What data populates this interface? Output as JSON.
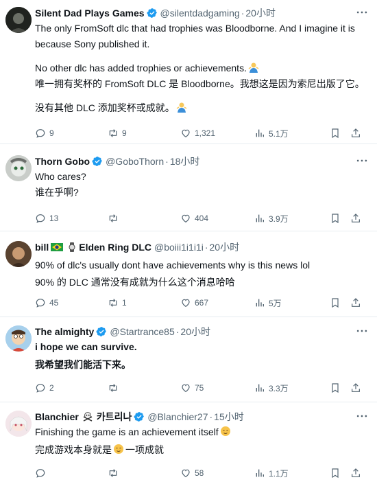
{
  "tweets": [
    {
      "name": "Silent Dad Plays Games",
      "handle": "@silentdadgaming",
      "time": "20小时",
      "lines": [
        "The only FromSoft dlc that had trophies was Bloodborne. And I imagine it is",
        "because Sony published it.",
        "No other dlc has added trophies or achievements.",
        "唯一拥有奖杯的 FromSoft DLC 是 Bloodborne。我想这是因为索尼出版了它。",
        "没有其他 DLC 添加奖杯或成就。"
      ],
      "replies": "9",
      "retweets": "9",
      "likes": "1,321",
      "views": "5.1万"
    },
    {
      "name": "Thorn Gobo",
      "handle": "@GoboThorn",
      "time": "18小时",
      "lines": [
        "Who cares?",
        "谁在乎啊?"
      ],
      "replies": "13",
      "retweets": "",
      "likes": "404",
      "views": "3.9万"
    },
    {
      "name": "bill",
      "name_suffix": "Elden Ring DLC",
      "handle": "@boiii1i1i1i",
      "time": "20小时",
      "lines": [
        "90% of dlc's usually dont have achievements why is this news lol",
        "90% 的 DLC 通常没有成就为什么这个消息哈哈"
      ],
      "replies": "45",
      "retweets": "1",
      "likes": "667",
      "views": "5万"
    },
    {
      "name": "The almighty",
      "handle": "@Startrance85",
      "time": "20小时",
      "lines": [
        "i hope we can survive.",
        "我希望我们能活下来。"
      ],
      "replies": "2",
      "retweets": "",
      "likes": "75",
      "views": "3.3万"
    },
    {
      "name": "Blanchier",
      "name_suffix": "카트리나",
      "handle": "@Blanchier27",
      "time": "15小时",
      "lines": [
        "Finishing the game is an achievement itself",
        "完成游戏本身就是",
        "一项成就"
      ],
      "replies": "",
      "retweets": "",
      "likes": "58",
      "views": "1.1万"
    }
  ],
  "colors": {
    "verified": "#1d9bf0",
    "text": "#0f1419",
    "muted": "#536471",
    "divider": "#e6ecf0"
  }
}
